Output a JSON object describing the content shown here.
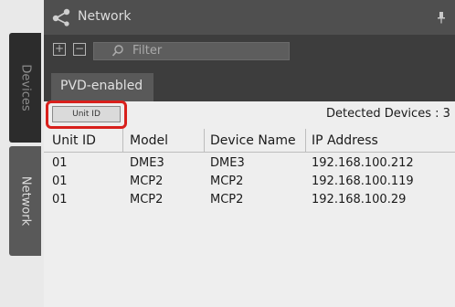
{
  "side_tabs": [
    {
      "label": "Devices"
    },
    {
      "label": "Network"
    }
  ],
  "panel": {
    "title": "Network",
    "icon": "share-network-icon"
  },
  "toolbar": {
    "expand_symbol": "+",
    "collapse_symbol": "−",
    "filter_placeholder": "Filter"
  },
  "tab": {
    "label": "PVD-enabled"
  },
  "unit_id_button": "Unit ID",
  "detected_devices": "Detected Devices : 3",
  "table": {
    "columns": [
      "Unit ID",
      "Model",
      "Device Name",
      "IP Address"
    ],
    "rows": [
      [
        "01",
        "DME3",
        "DME3",
        "192.168.100.212"
      ],
      [
        "01",
        "MCP2",
        "MCP2",
        "192.168.100.119"
      ],
      [
        "01",
        "MCP2",
        "MCP2",
        "192.168.100.29"
      ]
    ]
  },
  "colors": {
    "highlight": "#d8201c",
    "header_bg": "#4f4f4f",
    "toolbar_bg": "#3d3d3d"
  }
}
